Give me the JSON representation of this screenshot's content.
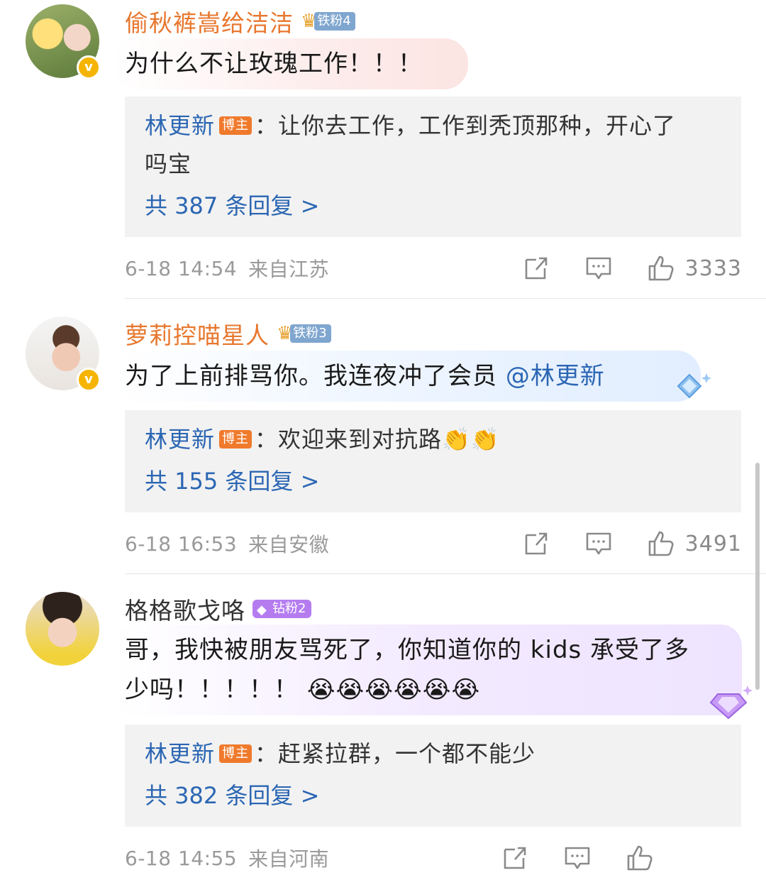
{
  "comments": [
    {
      "username": "偷秋裤嵩给洁洁",
      "fan_badge": "铁粉4",
      "text": "为什么不让玫瑰工作！！！",
      "reply": {
        "author": "林更新",
        "tag": "博主",
        "text": "：让你去工作，工作到秃顶那种，开心了",
        "text2": "吗宝",
        "count": "共 387 条回复 >"
      },
      "date": "6-18 14:54",
      "location": "来自江苏",
      "likes": "3333"
    },
    {
      "username": "萝莉控喵星人",
      "fan_badge": "铁粉3",
      "text": "为了上前排骂你。我连夜冲了会员 ",
      "mention": "@林更新",
      "reply": {
        "author": "林更新",
        "tag": "博主",
        "text": "：欢迎来到对抗路👏👏",
        "count": "共 155 条回复 >"
      },
      "date": "6-18 16:53",
      "location": "来自安徽",
      "likes": "3491"
    },
    {
      "username": "格格歌戈咯",
      "fan_badge": "钻粉2",
      "text": "哥，我快被朋友骂死了，你知道你的 kids 承受了多",
      "text2": "少吗！！！！！",
      "emojis": "😭😭😭😭😭😭",
      "reply": {
        "author": "林更新",
        "tag": "博主",
        "text": "：赶紧拉群，一个都不能少",
        "count": "共 382 条回复 >"
      },
      "date": "6-18 14:55",
      "location": "来自河南",
      "likes": ""
    }
  ],
  "icons": [
    "share-icon",
    "comment-icon",
    "like-icon",
    "verified-icon",
    "crown-icon",
    "diamond-icon"
  ],
  "colors": {
    "link_blue": "#2b66b3",
    "name_orange": "#e8772e",
    "host_tag": "#f07a2c",
    "iron_badge": "#7fa6cf",
    "diamond_badge": "#b57cf0"
  }
}
